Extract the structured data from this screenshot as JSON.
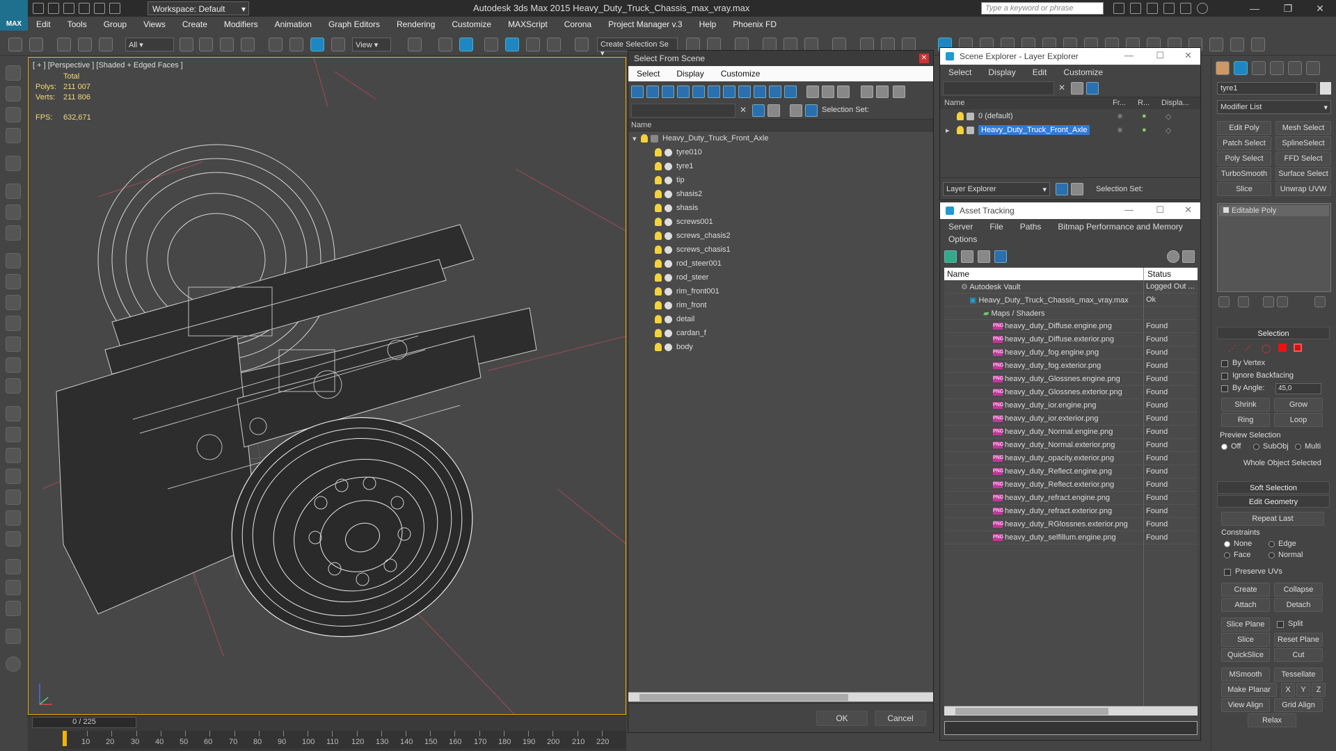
{
  "titlebar": {
    "workspace": "Workspace: Default",
    "app_title": "Autodesk 3ds Max  2015     Heavy_Duty_Truck_Chassis_max_vray.max",
    "search_placeholder": "Type a keyword or phrase",
    "logo": "MAX"
  },
  "menu": [
    "Edit",
    "Tools",
    "Group",
    "Views",
    "Create",
    "Modifiers",
    "Animation",
    "Graph Editors",
    "Rendering",
    "Customize",
    "MAXScript",
    "Corona",
    "Project Manager v.3",
    "Help",
    "Phoenix FD"
  ],
  "toolbar": {
    "filter": "All",
    "coord": "View",
    "selection_set": "Create Selection Se"
  },
  "viewport": {
    "label": "[ + ] [Perspective ] [Shaded + Edged Faces ]",
    "total_label": "Total",
    "polys_label": "Polys:",
    "polys_value": "211 007",
    "verts_label": "Verts:",
    "verts_value": "211 806",
    "fps_label": "FPS:",
    "fps_value": "632,671"
  },
  "timeline": {
    "frame": "0 / 225",
    "ticks": [
      "10",
      "20",
      "30",
      "40",
      "50",
      "60",
      "70",
      "80",
      "90",
      "100",
      "110",
      "120",
      "130",
      "140",
      "150",
      "160",
      "170",
      "180",
      "190",
      "200",
      "210",
      "220"
    ]
  },
  "select_from_scene": {
    "title": "Select From Scene",
    "menu": [
      "Select",
      "Display",
      "Customize"
    ],
    "selection_set_label": "Selection Set:",
    "name_header": "Name",
    "root": "Heavy_Duty_Truck_Front_Axle",
    "items": [
      "tyre010",
      "tyre1",
      "tip",
      "shasis2",
      "shasis",
      "screws001",
      "screws_chasis2",
      "screws_chasis1",
      "rod_steer001",
      "rod_steer",
      "rim_front001",
      "rim_front",
      "detail",
      "cardan_f",
      "body"
    ],
    "ok": "OK",
    "cancel": "Cancel"
  },
  "scene_explorer": {
    "title": "Scene Explorer - Layer Explorer",
    "menu": [
      "Select",
      "Display",
      "Edit",
      "Customize"
    ],
    "headers": {
      "name": "Name",
      "fr": "Fr...",
      "r": "R...",
      "disp": "Displa..."
    },
    "layers": [
      "0 (default)",
      "Heavy_Duty_Truck_Front_Axle"
    ],
    "footer_dropdown": "Layer Explorer",
    "footer_selset": "Selection Set:"
  },
  "asset_tracking": {
    "title": "Asset Tracking",
    "menu": [
      "Server",
      "File",
      "Paths",
      "Bitmap Performance and Memory"
    ],
    "menu2": "Options",
    "headers": {
      "name": "Name",
      "status": "Status"
    },
    "vault": {
      "name": "Autodesk Vault",
      "status": "Logged Out ..."
    },
    "maxfile": {
      "name": "Heavy_Duty_Truck_Chassis_max_vray.max",
      "status": "Ok"
    },
    "maps": "Maps / Shaders",
    "files": [
      {
        "name": "heavy_duty_Diffuse.engine.png",
        "status": "Found"
      },
      {
        "name": "heavy_duty_Diffuse.exterior.png",
        "status": "Found"
      },
      {
        "name": "heavy_duty_fog.engine.png",
        "status": "Found"
      },
      {
        "name": "heavy_duty_fog.exterior.png",
        "status": "Found"
      },
      {
        "name": "heavy_duty_Glossnes.engine.png",
        "status": "Found"
      },
      {
        "name": "heavy_duty_Glossnes.exterior.png",
        "status": "Found"
      },
      {
        "name": "heavy_duty_ior.engine.png",
        "status": "Found"
      },
      {
        "name": "heavy_duty_ior.exterior.png",
        "status": "Found"
      },
      {
        "name": "heavy_duty_Normal.engine.png",
        "status": "Found"
      },
      {
        "name": "heavy_duty_Normal.exterior.png",
        "status": "Found"
      },
      {
        "name": "heavy_duty_opacity.exterior.png",
        "status": "Found"
      },
      {
        "name": "heavy_duty_Reflect.engine.png",
        "status": "Found"
      },
      {
        "name": "heavy_duty_Reflect.exterior.png",
        "status": "Found"
      },
      {
        "name": "heavy_duty_refract.engine.png",
        "status": "Found"
      },
      {
        "name": "heavy_duty_refract.exterior.png",
        "status": "Found"
      },
      {
        "name": "heavy_duty_RGlossnes.exterior.png",
        "status": "Found"
      },
      {
        "name": "heavy_duty_selfillum.engine.png",
        "status": "Found"
      }
    ],
    "png_badge": "PNG"
  },
  "command_panel": {
    "object_name": "tyre1",
    "modifier_list": "Modifier List",
    "buttons": [
      "Edit Poly",
      "Mesh Select",
      "Patch Select",
      "SplineSelect",
      "Poly Select",
      "FFD Select",
      "TurboSmooth",
      "Surface Select",
      "Slice",
      "Unwrap UVW"
    ],
    "stack_item": "Editable Poly",
    "selection": "Selection",
    "by_vertex": "By Vertex",
    "ignore_backfacing": "Ignore Backfacing",
    "by_angle": "By Angle:",
    "angle_value": "45,0",
    "shrink": "Shrink",
    "grow": "Grow",
    "ring": "Ring",
    "loop": "Loop",
    "preview_selection": "Preview Selection",
    "preview_opts": [
      "Off",
      "SubObj",
      "Multi"
    ],
    "whole_object": "Whole Object Selected",
    "soft_selection": "Soft Selection",
    "edit_geometry": "Edit Geometry",
    "repeat_last": "Repeat Last",
    "constraints": "Constraints",
    "constraint_opts": [
      "None",
      "Edge",
      "Face",
      "Normal"
    ],
    "preserve_uvs": "Preserve UVs",
    "create": "Create",
    "collapse": "Collapse",
    "attach": "Attach",
    "detach": "Detach",
    "slice_plane": "Slice Plane",
    "split": "Split",
    "slice": "Slice",
    "reset_plane": "Reset Plane",
    "quickslice": "QuickSlice",
    "cut": "Cut",
    "msmooth": "MSmooth",
    "tessellate": "Tessellate",
    "make_planar": "Make Planar",
    "x": "X",
    "y": "Y",
    "z": "Z",
    "view_align": "View Align",
    "grid_align": "Grid Align",
    "relax": "Relax"
  }
}
